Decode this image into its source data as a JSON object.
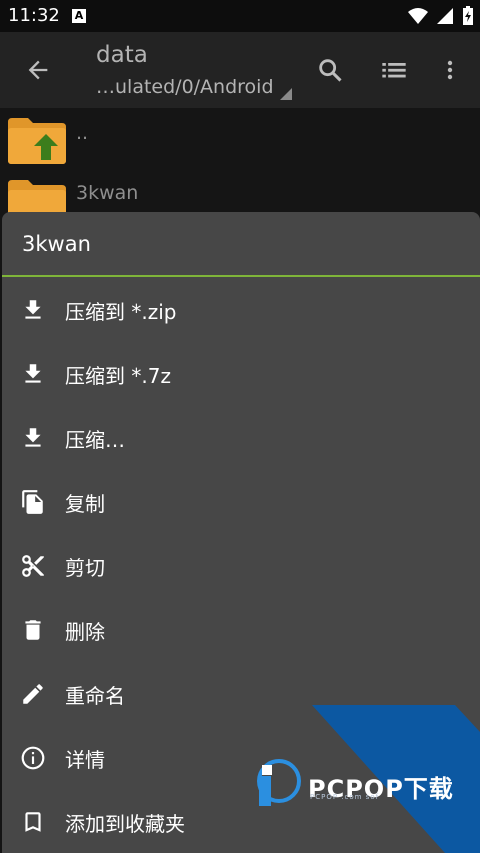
{
  "status_bar": {
    "time": "11:32",
    "notification_letter": "A"
  },
  "app_bar": {
    "title": "data",
    "path": "…ulated/0/Android"
  },
  "files": [
    {
      "name": ".."
    },
    {
      "name": "3kwan"
    }
  ],
  "sheet": {
    "title": "3kwan",
    "accent_color": "#7fb539",
    "items": [
      {
        "label": "压缩到 *.zip",
        "icon": "download-icon"
      },
      {
        "label": "压缩到 *.7z",
        "icon": "download-icon"
      },
      {
        "label": "压缩…",
        "icon": "download-icon"
      },
      {
        "label": "复制",
        "icon": "copy-icon"
      },
      {
        "label": "剪切",
        "icon": "scissors-icon"
      },
      {
        "label": "删除",
        "icon": "trash-icon"
      },
      {
        "label": "重命名",
        "icon": "pencil-icon"
      },
      {
        "label": "详情",
        "icon": "info-icon"
      },
      {
        "label": "添加到收藏夹",
        "icon": "bookmark-icon"
      }
    ]
  },
  "watermark": {
    "brand": "PCPOP下载",
    "tagline": "PCPOP   .com   sof"
  }
}
